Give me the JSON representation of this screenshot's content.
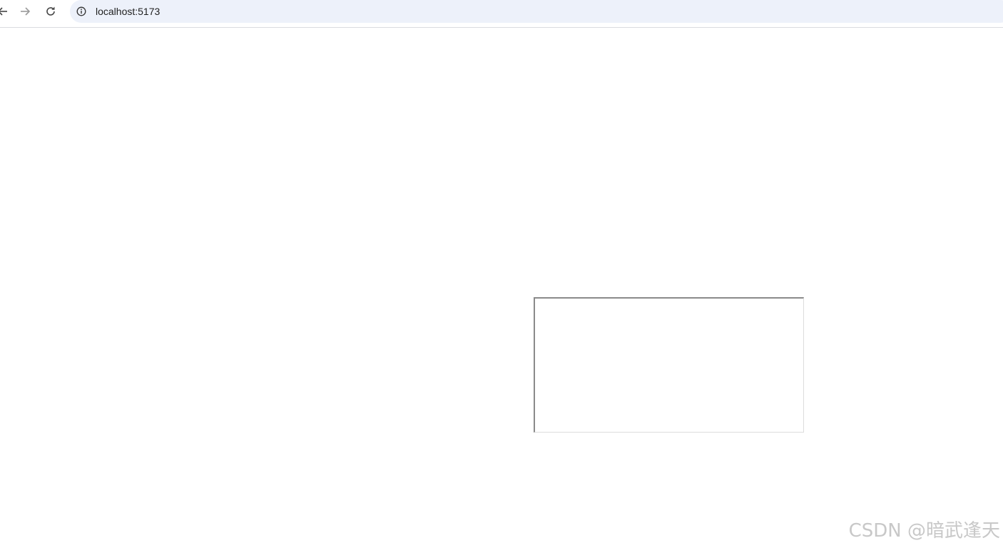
{
  "browser": {
    "url": "localhost:5173",
    "icons": {
      "back": "arrow-left-icon",
      "forward": "arrow-right-icon",
      "reload": "reload-icon",
      "site_info": "info-icon"
    }
  },
  "page": {
    "textarea": {
      "value": ""
    }
  },
  "watermark": {
    "text": "CSDN @暗武逢天"
  },
  "colors": {
    "omnibox_bg": "#edf1fa",
    "page_bg": "#ffffff",
    "watermark": "#c8c8c8"
  }
}
